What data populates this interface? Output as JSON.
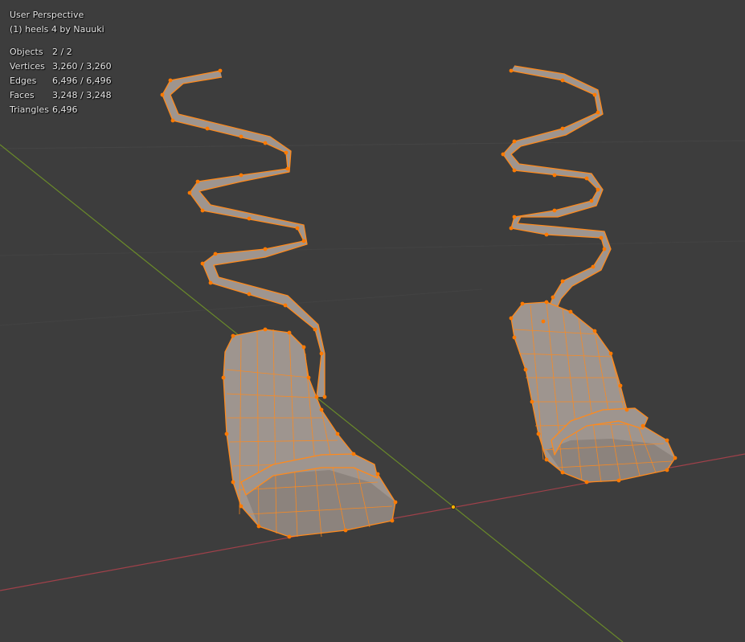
{
  "viewport": {
    "view_name": "User Perspective",
    "object_info": "(1) heels 4 by Nauuki"
  },
  "statistics": [
    {
      "label": "Objects",
      "value": "2 / 2"
    },
    {
      "label": "Vertices",
      "value": "3,260 / 3,260"
    },
    {
      "label": "Edges",
      "value": "6,496 / 6,496"
    },
    {
      "label": "Faces",
      "value": "3,248 / 3,248"
    },
    {
      "label": "Triangles",
      "value": "6,496"
    }
  ],
  "colors": {
    "background": "#3d3d3d",
    "x_axis": "#a0414a",
    "y_axis": "#6a8a2a",
    "selection_wire": "#ff8a1c",
    "mesh": "#9e958f"
  }
}
